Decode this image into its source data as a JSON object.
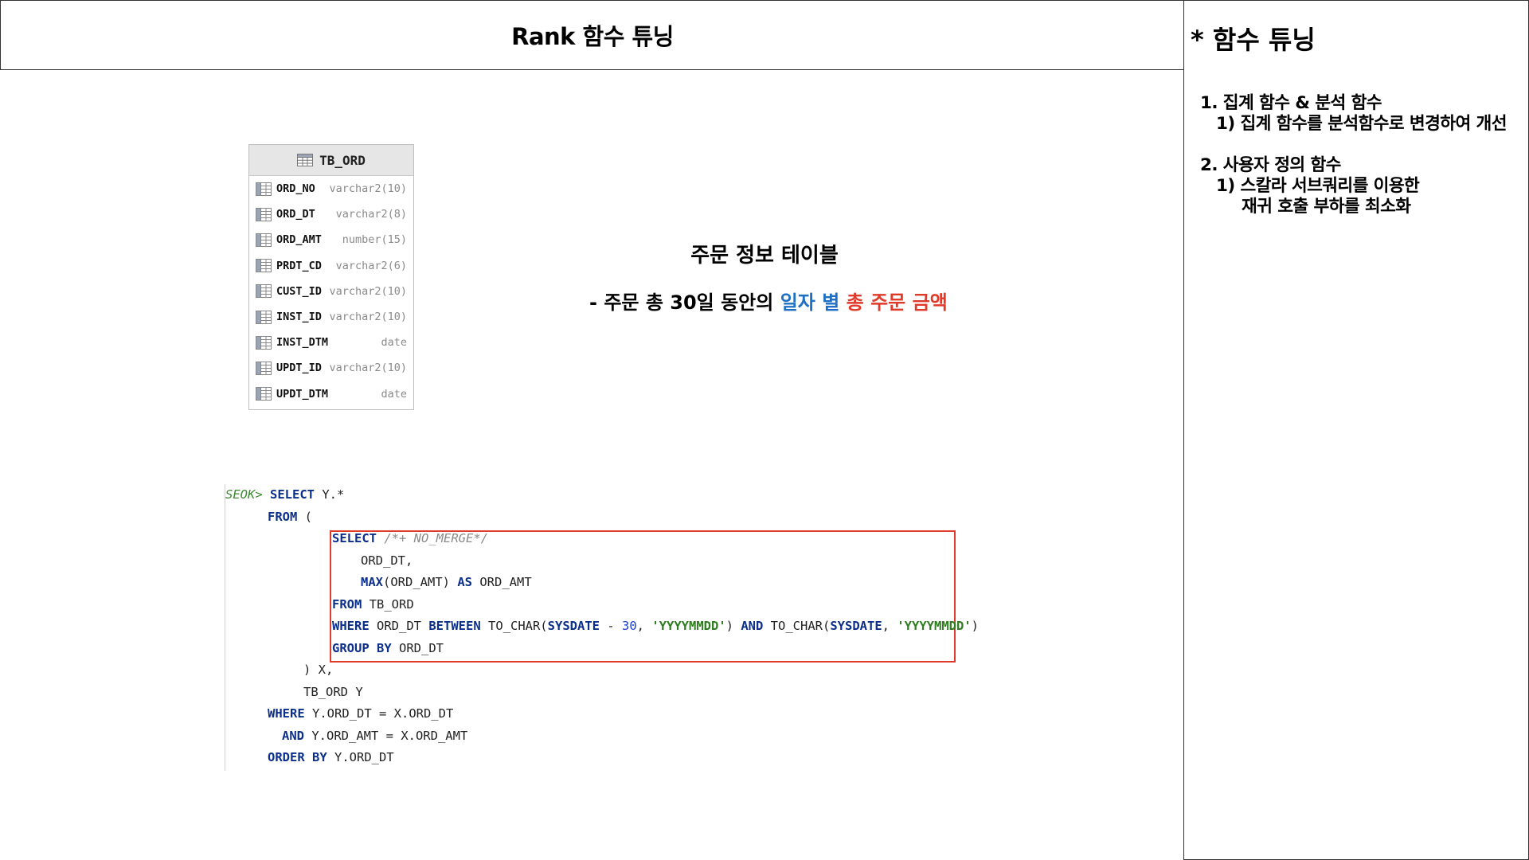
{
  "header": {
    "title": "Rank 함수 튜닝"
  },
  "panel": {
    "title": "* 함수 튜닝",
    "sections": [
      {
        "heading": "1.  집계 함수 & 분석 함수",
        "items": [
          "1)  집계 함수를 분석함수로 변경하여 개선"
        ]
      },
      {
        "heading": "2.  사용자 정의 함수",
        "items": [
          "1)  스칼라 서브쿼리를 이용한",
          "재귀 호출 부하를 최소화"
        ]
      }
    ]
  },
  "table": {
    "name": "TB_ORD",
    "columns": [
      {
        "name": "ORD_NO",
        "type": "varchar2(10)"
      },
      {
        "name": "ORD_DT",
        "type": "varchar2(8)"
      },
      {
        "name": "ORD_AMT",
        "type": "number(15)"
      },
      {
        "name": "PRDT_CD",
        "type": "varchar2(6)"
      },
      {
        "name": "CUST_ID",
        "type": "varchar2(10)"
      },
      {
        "name": "INST_ID",
        "type": "varchar2(10)"
      },
      {
        "name": "INST_DTM",
        "type": "date"
      },
      {
        "name": "UPDT_ID",
        "type": "varchar2(10)"
      },
      {
        "name": "UPDT_DTM",
        "type": "date"
      }
    ]
  },
  "caption": {
    "title": "주문 정보 테이블",
    "sub_prefix": "- 주문 총 30일 동안의 ",
    "sub_blue": "일자 별",
    "sub_red": "총 주문 금액"
  },
  "code": {
    "prompt": "SEOK>",
    "select": "SELECT",
    "from": "FROM",
    "as": "AS",
    "where": "WHERE",
    "between": "BETWEEN",
    "and": "AND",
    "group_by": "GROUP BY",
    "order_by": "ORDER BY",
    "max": "MAX",
    "sysdate": "SYSDATE",
    "hint": "/*+ NO_MERGE*/",
    "num30": "30",
    "fmt": "'YYYYMMDD'",
    "l1_rest": " Y.*",
    "l2_rest": " (",
    "l4": "ORD_DT,",
    "l5_rest": "(ORD_AMT) ",
    "l5_end": " ORD_AMT",
    "l6_rest": " TB_ORD",
    "w_a": " ORD_DT ",
    "w_b": " TO_CHAR(",
    "w_c": " - ",
    "w_d": ", ",
    "w_e": ") ",
    "w_f": " TO_CHAR(",
    "w_g": ", ",
    "w_h": ")",
    "l8_rest": " ORD_DT",
    "l9": ") X,",
    "l10": "TB_ORD Y",
    "l11_rest": " Y.ORD_DT = X.ORD_DT",
    "l12_rest": " Y.ORD_AMT = X.ORD_AMT",
    "l13_rest": " Y.ORD_DT"
  }
}
